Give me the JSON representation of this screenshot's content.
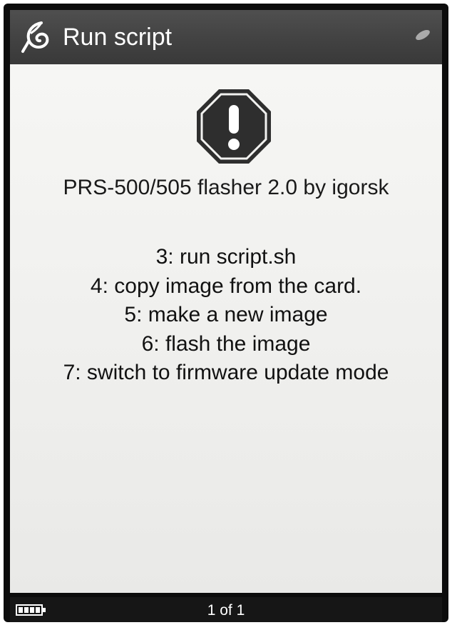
{
  "header": {
    "title": "Run script",
    "icon": "leaf-icon"
  },
  "dialog": {
    "icon": "warning-octagon-icon",
    "heading": "PRS-500/505 flasher 2.0 by igorsk",
    "steps": [
      "3: run script.sh",
      "4: copy image from the card.",
      "5: make a new image",
      "6: flash the image",
      "7: switch to firmware update mode"
    ]
  },
  "footer": {
    "battery_icon": "battery-icon",
    "page_indicator": "1 of 1"
  },
  "colors": {
    "titlebar": "#444444",
    "screen": "#f0f0ee",
    "statusbar": "#161616",
    "icon_dark": "#2e2e2e"
  }
}
